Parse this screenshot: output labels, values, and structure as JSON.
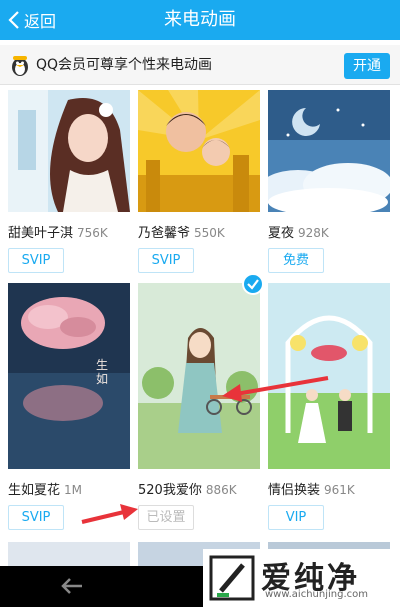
{
  "header": {
    "back_label": "返回",
    "title": "来电动画"
  },
  "promo": {
    "text": "QQ会员可尊享个性来电动画",
    "open_label": "开通"
  },
  "items": [
    {
      "name": "甜美叶子淇",
      "size": "756K",
      "badge": "SVIP"
    },
    {
      "name": "乃爸馨爷",
      "size": "550K",
      "badge": "SVIP"
    },
    {
      "name": "夏夜",
      "size": "928K",
      "badge": "免费"
    },
    {
      "name": "生如夏花",
      "size": "1M",
      "badge": "SVIP"
    },
    {
      "name": "520我爱你",
      "size": "886K",
      "badge": "已设置"
    },
    {
      "name": "情侣换装",
      "size": "961K",
      "badge": "VIP"
    }
  ],
  "watermark": {
    "text": "爱纯净",
    "url": "www.aichunjing.com"
  },
  "colors": {
    "accent": "#1aaaf0",
    "arrow": "#e8333a",
    "nav": "#000000"
  }
}
